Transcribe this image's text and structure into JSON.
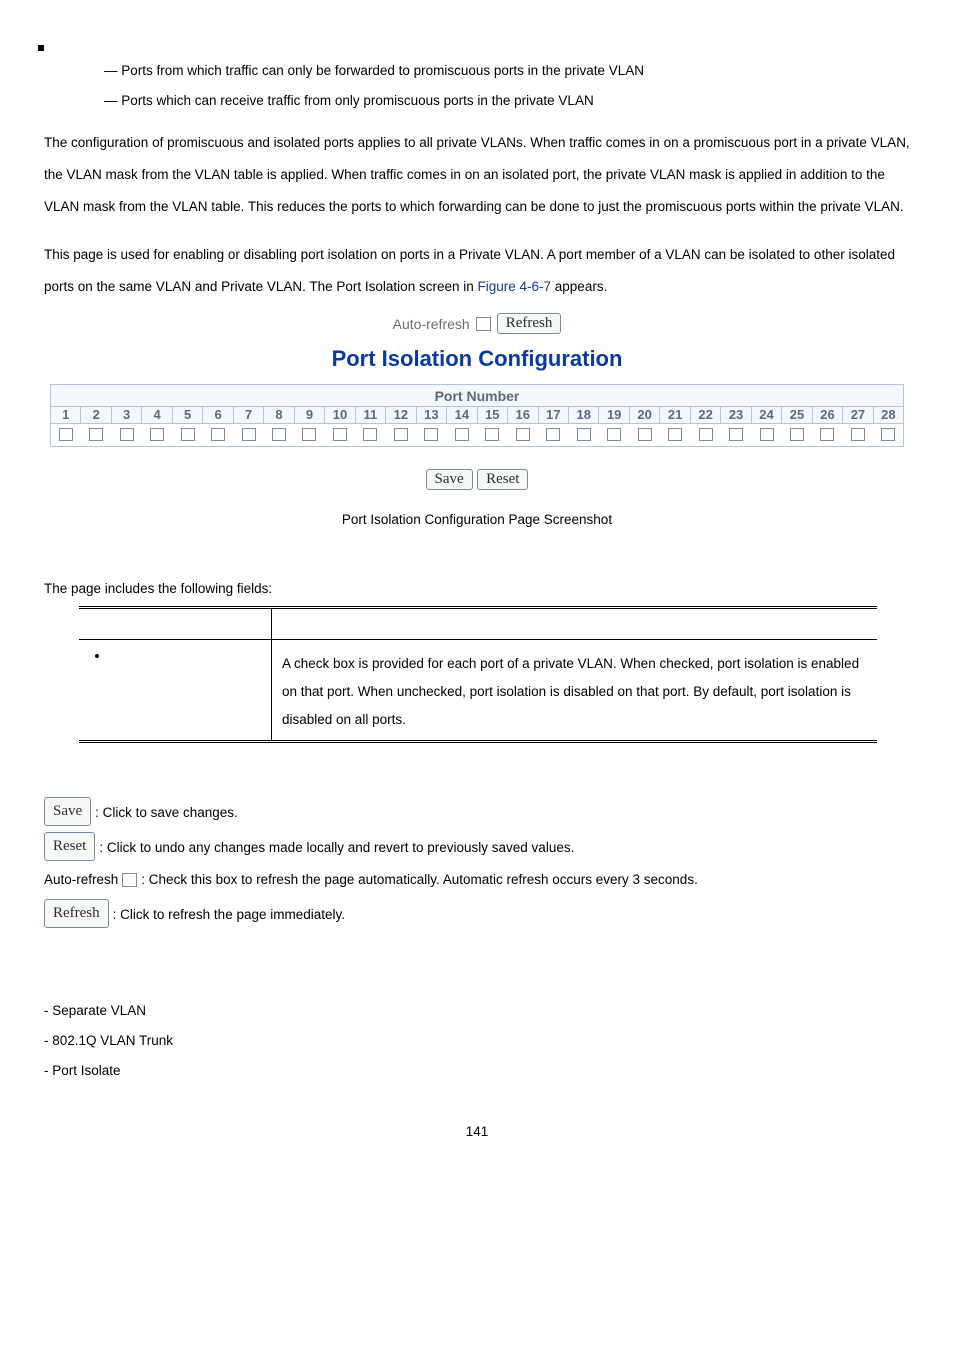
{
  "dashes": {
    "line1": "— Ports from which traffic can only be forwarded to promiscuous ports in the private VLAN",
    "line2": "— Ports which can receive traffic from only promiscuous ports in the private VLAN"
  },
  "para1": "The configuration of promiscuous and isolated ports applies to all private VLANs. When traffic comes in on a promiscuous port in a private VLAN, the VLAN mask from the VLAN table is applied. When traffic comes in on an isolated port, the private VLAN mask is applied in addition to the VLAN mask from the VLAN table. This reduces the ports to which forwarding can be done to just the promiscuous ports within the private VLAN.",
  "para2_pre": "This page is used for enabling or disabling port isolation on ports in a Private VLAN. A port member of a VLAN can be isolated to other isolated ports on the same VLAN and Private VLAN. The Port Isolation screen in ",
  "figure_ref": "Figure 4-6-7",
  "para2_post": " appears.",
  "screenshot": {
    "auto_refresh_label": "Auto-refresh",
    "refresh_btn": "Refresh",
    "title": "Port Isolation Configuration",
    "port_header": "Port Number",
    "ports": [
      "1",
      "2",
      "3",
      "4",
      "5",
      "6",
      "7",
      "8",
      "9",
      "10",
      "11",
      "12",
      "13",
      "14",
      "15",
      "16",
      "17",
      "18",
      "19",
      "20",
      "21",
      "22",
      "23",
      "24",
      "25",
      "26",
      "27",
      "28"
    ],
    "save_btn": "Save",
    "reset_btn": "Reset"
  },
  "fig_caption": "Port Isolation Configuration Page Screenshot",
  "fields_intro": "The page includes the following fields:",
  "fields_table": {
    "desc": "A check box is provided for each port of a private VLAN. When checked, port isolation is enabled on that port. When unchecked, port isolation is disabled on that port. By default, port isolation is disabled on all ports."
  },
  "buttons": {
    "save_label": "Save",
    "save_desc": ": Click to save changes.",
    "reset_label": "Reset",
    "reset_desc": ": Click to undo any changes made locally and revert to previously saved values.",
    "auto_prefix": "Auto-refresh ",
    "auto_desc": ": Check this box to refresh the page automatically. Automatic refresh occurs every 3 seconds.",
    "refresh_label": "Refresh",
    "refresh_desc": ": Click to refresh the page immediately."
  },
  "bottom_list": {
    "i1": "- Separate VLAN",
    "i2": "- 802.1Q VLAN Trunk",
    "i3": "- Port Isolate"
  },
  "page_number": "141"
}
